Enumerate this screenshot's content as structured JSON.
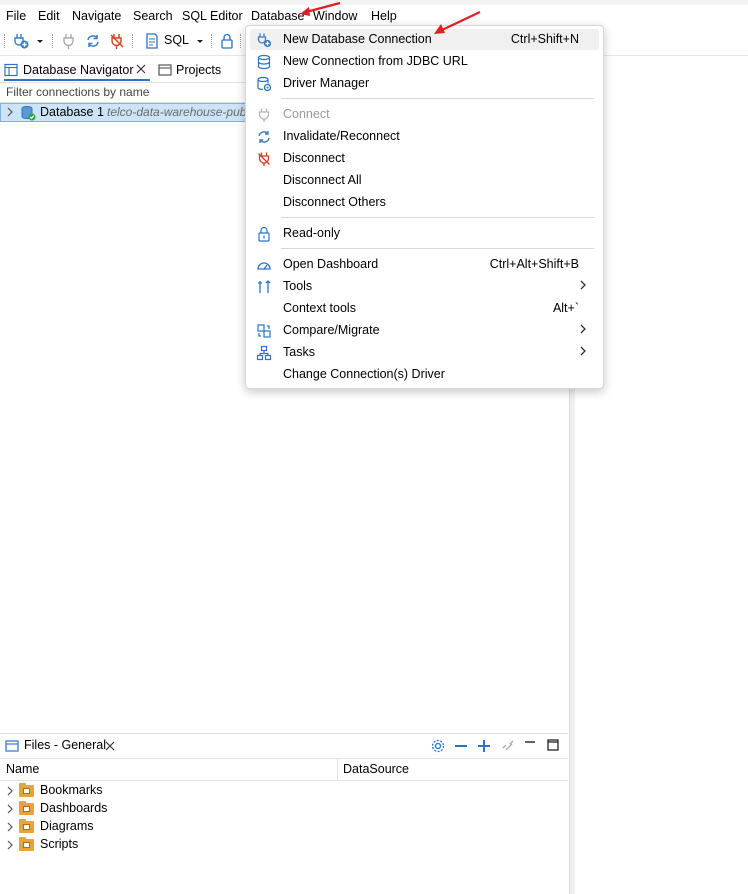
{
  "menubar": {
    "items": [
      "File",
      "Edit",
      "Navigate",
      "Search",
      "SQL Editor",
      "Database",
      "Window",
      "Help"
    ]
  },
  "toolbar": {
    "sql_label": "SQL"
  },
  "navigator": {
    "tabs": [
      "Database Navigator",
      "Projects"
    ],
    "filter_placeholder": "Filter connections by name",
    "connection_name": "Database 1",
    "connection_desc": "telco-data-warehouse-pub"
  },
  "files": {
    "title": "Files - General",
    "columns": [
      "Name",
      "DataSource"
    ],
    "folders": [
      "Bookmarks",
      "Dashboards",
      "Diagrams",
      "Scripts"
    ]
  },
  "database_menu": {
    "items": [
      {
        "label": "New Database Connection",
        "shortcut": "Ctrl+Shift+N",
        "icon": "new-connection-icon"
      },
      {
        "label": "New Connection from JDBC URL",
        "shortcut": "",
        "icon": "database-icon"
      },
      {
        "label": "Driver Manager",
        "shortcut": "",
        "icon": "driver-manager-icon"
      },
      {
        "label": "Connect",
        "shortcut": "",
        "icon": "connect-plug-icon",
        "disabled": true
      },
      {
        "label": "Invalidate/Reconnect",
        "shortcut": "",
        "icon": "reconnect-icon"
      },
      {
        "label": "Disconnect",
        "shortcut": "",
        "icon": "disconnect-icon"
      },
      {
        "label": "Disconnect All",
        "shortcut": ""
      },
      {
        "label": "Disconnect Others",
        "shortcut": ""
      },
      {
        "label": "Read-only",
        "shortcut": "",
        "icon": "lock-icon"
      },
      {
        "label": "Open Dashboard",
        "shortcut": "Ctrl+Alt+Shift+B",
        "icon": "dashboard-icon"
      },
      {
        "label": "Tools",
        "shortcut": "",
        "icon": "tools-icon",
        "submenu": true
      },
      {
        "label": "Context tools",
        "shortcut": "Alt+`"
      },
      {
        "label": "Compare/Migrate",
        "shortcut": "",
        "icon": "compare-icon",
        "submenu": true
      },
      {
        "label": "Tasks",
        "shortcut": "",
        "icon": "tasks-icon",
        "submenu": true
      },
      {
        "label": "Change Connection(s) Driver",
        "shortcut": ""
      }
    ]
  },
  "colors": {
    "accent": "#2b73c6",
    "selection": "#cce4f7",
    "annotation_arrow": "#e02020",
    "folder": "#e8a33d"
  }
}
